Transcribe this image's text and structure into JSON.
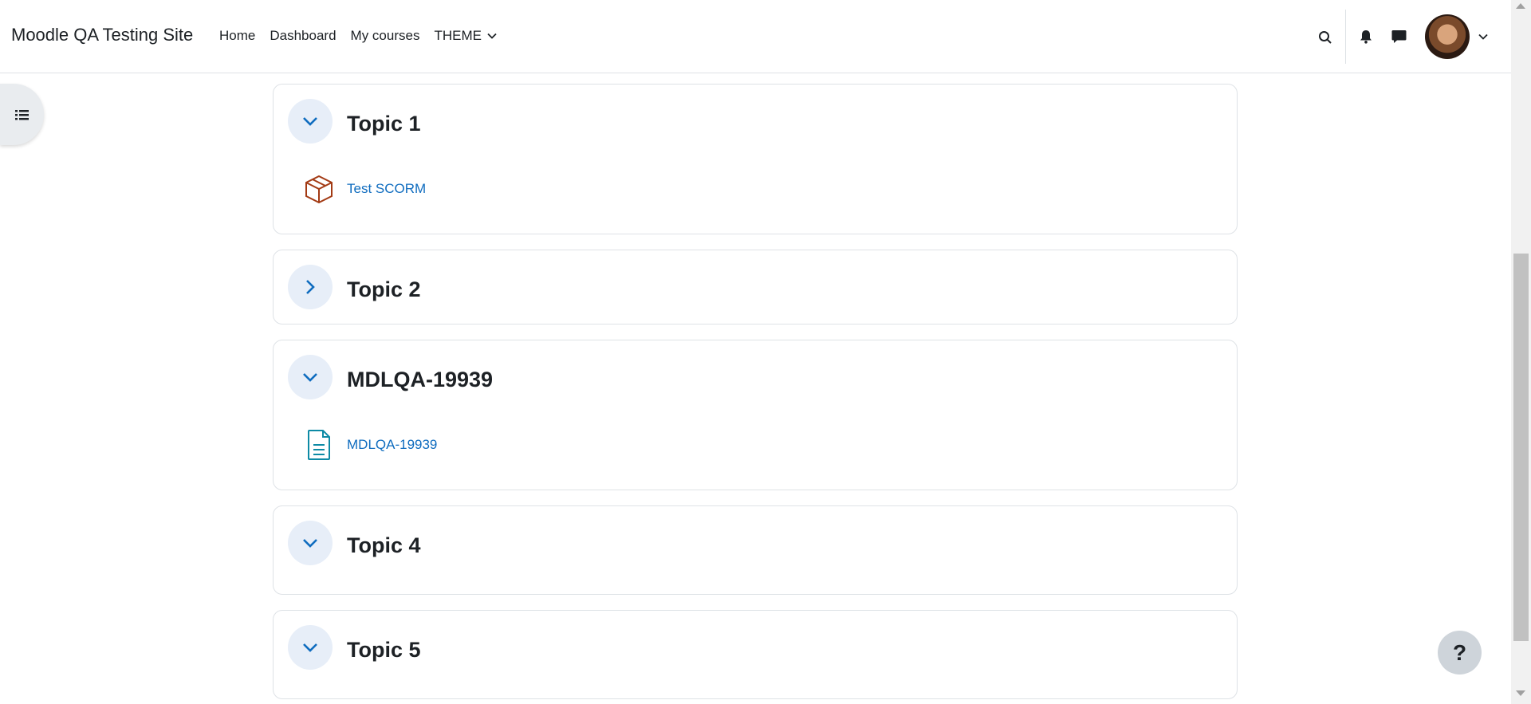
{
  "header": {
    "site_name": "Moodle QA Testing Site",
    "nav": [
      "Home",
      "Dashboard",
      "My courses",
      "THEME"
    ]
  },
  "icons": {
    "search": "search-icon",
    "notifications": "bell-icon",
    "messages": "message-icon",
    "user_menu": "chevron-down-icon",
    "drawer": "list-icon",
    "help": "?"
  },
  "sections": [
    {
      "title": "Topic 1",
      "expanded": true,
      "activities": [
        {
          "name": "Test SCORM",
          "icon": "scorm-package-icon"
        }
      ]
    },
    {
      "title": "Topic 2",
      "expanded": false,
      "activities": []
    },
    {
      "title": "MDLQA-19939",
      "expanded": true,
      "activities": [
        {
          "name": "MDLQA-19939",
          "icon": "page-icon"
        }
      ]
    },
    {
      "title": "Topic 4",
      "expanded": true,
      "activities": []
    },
    {
      "title": "Topic 5",
      "expanded": true,
      "activities": []
    }
  ],
  "colors": {
    "link": "#0f6cbf",
    "scorm": "#a33a14",
    "page": "#0d8aa5",
    "collapse_bg": "#e7eef8"
  }
}
